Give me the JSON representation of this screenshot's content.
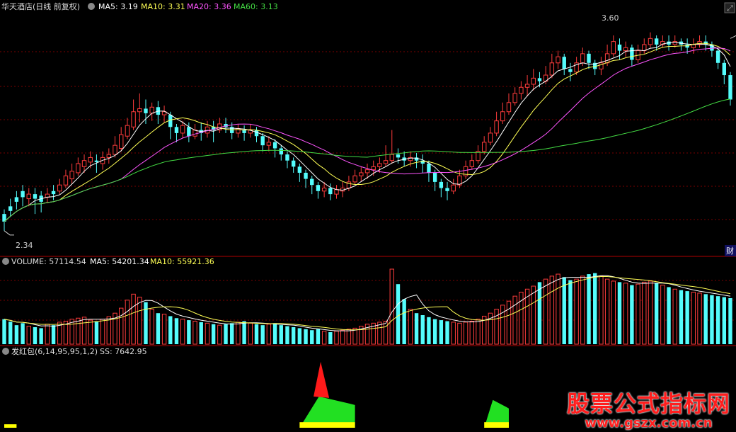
{
  "header": {
    "title": "华天酒店(日线 前复权)",
    "ma5": "MA5: 3.19",
    "ma10": "MA10: 3.31",
    "ma20": "MA20: 3.36",
    "ma60": "MA60: 3.13"
  },
  "volume_header": {
    "volume": "VOLUME: 57114.54",
    "ma5": "MA5: 54201.34",
    "ma10": "MA10: 55921.36"
  },
  "indicator_header": {
    "name": "发红包(6,14,95,95,1,2)",
    "ss": "SS: 7642.95"
  },
  "side_tab": "财",
  "watermark": {
    "main": "股票公式指标网",
    "sub": "www.gszx.com.cn"
  },
  "colors": {
    "up": "#ff3c3c",
    "down": "#54fcfc",
    "grid": "#7a0000",
    "ma5": "#ffffff",
    "ma10": "#ffff55",
    "ma20": "#ff55ff",
    "ma60": "#44dd44"
  },
  "chart_data": [
    {
      "type": "candlestick",
      "title": "华天酒店(日线 前复权)",
      "x": "trading days (unlabeled)",
      "ylim": [
        2.2,
        3.75
      ],
      "annotations": [
        {
          "label": "2.34",
          "value": 2.34,
          "index": 0
        },
        {
          "label": "3.60",
          "value": 3.6,
          "index": 118
        }
      ],
      "candles": [
        [
          2.45,
          2.4,
          2.48,
          2.34
        ],
        [
          2.5,
          2.47,
          2.55,
          2.43
        ],
        [
          2.56,
          2.53,
          2.6,
          2.48
        ],
        [
          2.6,
          2.56,
          2.64,
          2.5
        ],
        [
          2.55,
          2.58,
          2.62,
          2.5
        ],
        [
          2.58,
          2.55,
          2.62,
          2.45
        ],
        [
          2.57,
          2.53,
          2.6,
          2.46
        ],
        [
          2.56,
          2.58,
          2.62,
          2.52
        ],
        [
          2.6,
          2.58,
          2.64,
          2.54
        ],
        [
          2.6,
          2.64,
          2.68,
          2.58
        ],
        [
          2.64,
          2.7,
          2.74,
          2.62
        ],
        [
          2.68,
          2.73,
          2.78,
          2.65
        ],
        [
          2.72,
          2.78,
          2.82,
          2.7
        ],
        [
          2.76,
          2.8,
          2.84,
          2.72
        ],
        [
          2.79,
          2.82,
          2.86,
          2.75
        ],
        [
          2.8,
          2.79,
          2.84,
          2.72
        ],
        [
          2.78,
          2.82,
          2.86,
          2.74
        ],
        [
          2.82,
          2.84,
          2.88,
          2.78
        ],
        [
          2.84,
          2.9,
          2.96,
          2.82
        ],
        [
          2.88,
          2.97,
          3.02,
          2.86
        ],
        [
          2.96,
          3.03,
          3.08,
          2.94
        ],
        [
          3.02,
          3.12,
          3.2,
          3.0
        ],
        [
          3.12,
          3.14,
          3.24,
          3.05
        ],
        [
          3.14,
          3.11,
          3.2,
          3.04
        ],
        [
          3.11,
          3.15,
          3.18,
          3.06
        ],
        [
          3.15,
          3.1,
          3.19,
          3.04
        ],
        [
          3.1,
          3.12,
          3.16,
          3.05
        ],
        [
          3.1,
          3.02,
          3.12,
          2.94
        ],
        [
          3.02,
          2.98,
          3.04,
          2.92
        ],
        [
          2.98,
          3.03,
          3.06,
          2.95
        ],
        [
          3.02,
          2.96,
          3.05,
          2.92
        ],
        [
          2.96,
          3.0,
          3.04,
          2.94
        ],
        [
          3.0,
          2.98,
          3.05,
          2.93
        ],
        [
          2.98,
          3.02,
          3.06,
          2.95
        ],
        [
          3.02,
          3.0,
          3.06,
          2.92
        ],
        [
          3.0,
          3.04,
          3.08,
          2.98
        ],
        [
          3.04,
          3.02,
          3.08,
          2.98
        ],
        [
          3.02,
          2.98,
          3.05,
          2.94
        ],
        [
          2.98,
          3.01,
          3.04,
          2.95
        ],
        [
          3.0,
          2.98,
          3.03,
          2.93
        ],
        [
          2.98,
          3.0,
          3.04,
          2.95
        ],
        [
          3.0,
          2.96,
          3.02,
          2.92
        ],
        [
          2.96,
          2.9,
          2.98,
          2.86
        ],
        [
          2.9,
          2.92,
          2.96,
          2.86
        ],
        [
          2.92,
          2.88,
          2.94,
          2.82
        ],
        [
          2.88,
          2.84,
          2.9,
          2.8
        ],
        [
          2.84,
          2.8,
          2.86,
          2.75
        ],
        [
          2.8,
          2.76,
          2.82,
          2.72
        ],
        [
          2.76,
          2.72,
          2.78,
          2.66
        ],
        [
          2.72,
          2.68,
          2.74,
          2.62
        ],
        [
          2.68,
          2.64,
          2.7,
          2.58
        ],
        [
          2.64,
          2.6,
          2.66,
          2.55
        ],
        [
          2.6,
          2.62,
          2.66,
          2.56
        ],
        [
          2.62,
          2.58,
          2.65,
          2.54
        ],
        [
          2.58,
          2.61,
          2.64,
          2.55
        ],
        [
          2.6,
          2.62,
          2.66,
          2.56
        ],
        [
          2.62,
          2.66,
          2.7,
          2.6
        ],
        [
          2.66,
          2.7,
          2.74,
          2.64
        ],
        [
          2.7,
          2.72,
          2.76,
          2.66
        ],
        [
          2.72,
          2.74,
          2.78,
          2.68
        ],
        [
          2.74,
          2.76,
          2.8,
          2.7
        ],
        [
          2.76,
          2.78,
          2.82,
          2.72
        ],
        [
          2.78,
          2.8,
          2.9,
          2.76
        ],
        [
          2.8,
          2.84,
          3.0,
          2.78
        ],
        [
          2.84,
          2.82,
          2.88,
          2.78
        ],
        [
          2.82,
          2.8,
          2.86,
          2.76
        ],
        [
          2.8,
          2.82,
          2.86,
          2.76
        ],
        [
          2.82,
          2.8,
          2.85,
          2.75
        ],
        [
          2.8,
          2.78,
          2.84,
          2.72
        ],
        [
          2.78,
          2.72,
          2.8,
          2.66
        ],
        [
          2.72,
          2.66,
          2.74,
          2.6
        ],
        [
          2.66,
          2.62,
          2.68,
          2.56
        ],
        [
          2.62,
          2.6,
          2.66,
          2.54
        ],
        [
          2.6,
          2.64,
          2.68,
          2.58
        ],
        [
          2.64,
          2.7,
          2.74,
          2.62
        ],
        [
          2.7,
          2.76,
          2.8,
          2.68
        ],
        [
          2.76,
          2.8,
          2.84,
          2.74
        ],
        [
          2.8,
          2.86,
          2.9,
          2.78
        ],
        [
          2.86,
          2.92,
          2.96,
          2.84
        ],
        [
          2.92,
          2.98,
          3.02,
          2.9
        ],
        [
          2.98,
          3.06,
          3.12,
          2.96
        ],
        [
          3.06,
          3.12,
          3.18,
          3.04
        ],
        [
          3.12,
          3.18,
          3.24,
          3.1
        ],
        [
          3.18,
          3.24,
          3.28,
          3.16
        ],
        [
          3.24,
          3.28,
          3.32,
          3.2
        ],
        [
          3.28,
          3.3,
          3.36,
          3.22
        ],
        [
          3.3,
          3.34,
          3.4,
          3.26
        ],
        [
          3.34,
          3.32,
          3.38,
          3.28
        ],
        [
          3.32,
          3.36,
          3.42,
          3.3
        ],
        [
          3.36,
          3.44,
          3.5,
          3.34
        ],
        [
          3.44,
          3.48,
          3.52,
          3.4
        ],
        [
          3.48,
          3.4,
          3.5,
          3.36
        ],
        [
          3.4,
          3.38,
          3.44,
          3.32
        ],
        [
          3.38,
          3.44,
          3.48,
          3.36
        ],
        [
          3.44,
          3.5,
          3.54,
          3.42
        ],
        [
          3.5,
          3.44,
          3.52,
          3.4
        ],
        [
          3.44,
          3.4,
          3.46,
          3.36
        ],
        [
          3.4,
          3.44,
          3.48,
          3.36
        ],
        [
          3.44,
          3.5,
          3.56,
          3.42
        ],
        [
          3.5,
          3.58,
          3.62,
          3.48
        ],
        [
          3.56,
          3.52,
          3.6,
          3.46
        ],
        [
          3.52,
          3.54,
          3.58,
          3.48
        ],
        [
          3.54,
          3.46,
          3.56,
          3.42
        ],
        [
          3.46,
          3.52,
          3.56,
          3.44
        ],
        [
          3.52,
          3.56,
          3.6,
          3.5
        ],
        [
          3.56,
          3.6,
          3.64,
          3.54
        ],
        [
          3.6,
          3.56,
          3.62,
          3.52
        ],
        [
          3.56,
          3.58,
          3.62,
          3.54
        ],
        [
          3.58,
          3.56,
          3.62,
          3.52
        ],
        [
          3.56,
          3.58,
          3.62,
          3.54
        ],
        [
          3.58,
          3.56,
          3.6,
          3.52
        ],
        [
          3.56,
          3.54,
          3.6,
          3.5
        ],
        [
          3.54,
          3.56,
          3.6,
          3.5
        ],
        [
          3.56,
          3.58,
          3.62,
          3.54
        ],
        [
          3.58,
          3.56,
          3.62,
          3.52
        ],
        [
          3.56,
          3.52,
          3.58,
          3.48
        ],
        [
          3.52,
          3.44,
          3.54,
          3.4
        ],
        [
          3.44,
          3.36,
          3.46,
          3.3
        ],
        [
          3.36,
          3.2,
          3.38,
          3.16
        ]
      ]
    },
    {
      "type": "bar",
      "title": "VOLUME",
      "series": [
        {
          "name": "VOLUME",
          "values": [
            50,
            45,
            38,
            42,
            36,
            34,
            32,
            40,
            38,
            44,
            46,
            50,
            52,
            54,
            48,
            46,
            50,
            55,
            62,
            72,
            88,
            100,
            94,
            84,
            70,
            62,
            60,
            56,
            52,
            50,
            48,
            46,
            44,
            42,
            40,
            38,
            40,
            42,
            44,
            46,
            42,
            40,
            38,
            40,
            42,
            38,
            36,
            34,
            32,
            30,
            28,
            30,
            26,
            24,
            26,
            28,
            30,
            32,
            36,
            40,
            42,
            44,
            46,
            150,
            120,
            90,
            70,
            62,
            58,
            54,
            50,
            48,
            46,
            44,
            42,
            44,
            46,
            50,
            56,
            62,
            70,
            78,
            86,
            96,
            104,
            110,
            116,
            124,
            130,
            136,
            140,
            134,
            128,
            130,
            136,
            140,
            142,
            136,
            130,
            126,
            124,
            122,
            118,
            120,
            124,
            126,
            122,
            118,
            114,
            110,
            108,
            106,
            104,
            102,
            100,
            98,
            96,
            94,
            92,
            90
          ]
        }
      ]
    },
    {
      "type": "area",
      "title": "发红包(6,14,95,95,1,2)",
      "series": [
        {
          "name": "SS",
          "values": [
            1,
            0,
            0,
            0,
            0,
            0,
            0,
            0,
            0,
            0,
            0,
            0,
            0,
            0,
            0,
            0,
            0,
            0,
            0,
            0,
            0,
            0,
            0,
            0,
            0,
            0,
            0,
            0,
            0,
            0,
            0,
            0,
            0,
            0,
            0,
            0,
            0,
            0,
            0,
            0,
            0,
            0,
            0,
            0,
            0,
            0,
            0,
            0,
            0,
            0,
            0,
            0,
            0,
            0,
            0,
            0,
            0,
            0,
            0,
            0,
            0,
            0,
            0,
            0,
            0,
            0,
            0,
            0,
            0,
            0,
            0,
            0,
            0,
            0,
            0,
            0,
            0,
            0,
            0,
            0,
            0,
            0,
            0,
            0,
            0,
            0,
            0,
            0,
            0,
            0,
            0,
            0,
            0,
            0,
            0,
            0,
            0,
            0,
            0,
            0,
            0,
            0,
            0,
            0,
            0,
            0,
            0,
            0,
            0,
            0,
            0,
            0,
            0,
            0,
            0,
            0,
            0,
            0,
            0,
            0
          ]
        }
      ],
      "regions": [
        {
          "start": 48,
          "end": 57,
          "green_peak": 0.45,
          "red_peak": 0.95,
          "yellow": 0.08
        },
        {
          "start": 78,
          "end": 82,
          "green_peak": 0.4,
          "red_peak": 0,
          "yellow": 0.08
        },
        {
          "start": 0,
          "end": 2,
          "green_peak": 0,
          "red_peak": 0,
          "yellow": 0.05
        }
      ]
    }
  ]
}
